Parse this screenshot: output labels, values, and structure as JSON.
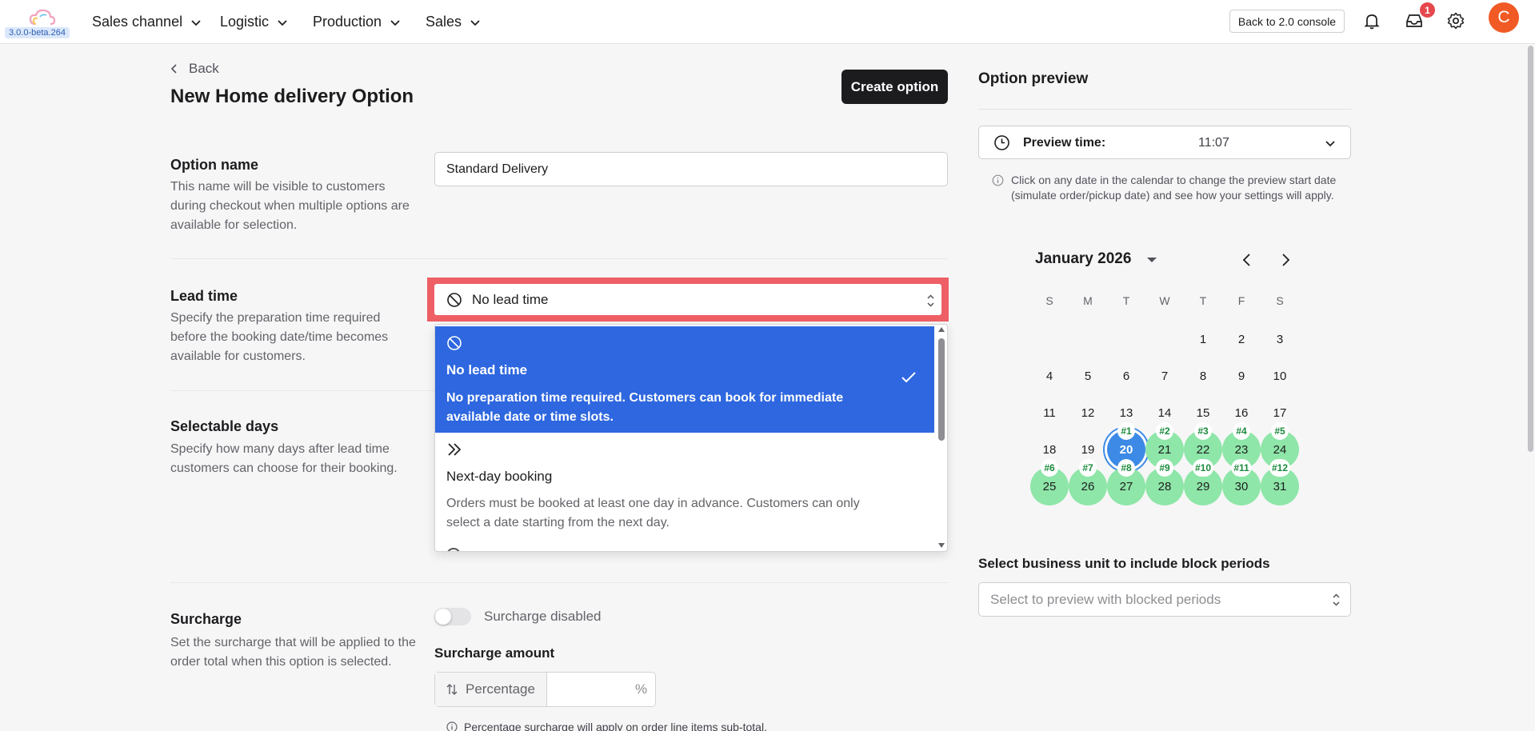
{
  "app": {
    "version": "3.0.0-beta.264"
  },
  "nav": {
    "items": [
      {
        "label": "Sales channel"
      },
      {
        "label": "Logistic"
      },
      {
        "label": "Production"
      },
      {
        "label": "Sales"
      }
    ]
  },
  "header": {
    "back_console": "Back to 2.0 console",
    "inbox_badge": "1",
    "avatar_initial": "C"
  },
  "page": {
    "back": "Back",
    "title": "New Home delivery Option",
    "create_button": "Create option"
  },
  "option_name": {
    "title": "Option name",
    "desc": "This name will be visible to customers during checkout when multiple options are available for selection.",
    "value": "Standard Delivery"
  },
  "lead_time": {
    "title": "Lead time",
    "desc": "Specify the preparation time required before the booking date/time becomes available for customers.",
    "selected": "No lead time",
    "options": [
      {
        "title": "No lead time",
        "desc": "No preparation time required. Customers can book for immediate available date or time slots.",
        "icon": "ban-icon",
        "selected": true
      },
      {
        "title": "Next-day booking",
        "desc": "Orders must be booked at least one day in advance. Customers can only select a date starting from the next day.",
        "icon": "double-chevron-right-icon"
      }
    ]
  },
  "selectable_days": {
    "title": "Selectable days",
    "desc": "Specify how many days after lead time customers can choose for their booking."
  },
  "surcharge": {
    "title": "Surcharge",
    "desc": "Set the surcharge that will be applied to the order total when this option is selected.",
    "toggle_label": "Surcharge disabled",
    "enabled": false,
    "amount_label": "Surcharge amount",
    "type": "Percentage",
    "unit": "%",
    "note": "Percentage surcharge will apply on order line items sub-total."
  },
  "preview": {
    "title": "Option preview",
    "time_label": "Preview time:",
    "time_value": "11:07",
    "info": "Click on any date in the calendar to change the preview start date (simulate order/pickup date) and see how your settings will apply.",
    "month": "January 2026",
    "weekdays": [
      "S",
      "M",
      "T",
      "W",
      "T",
      "F",
      "S"
    ],
    "today": 20,
    "tags": {
      "20": "#1",
      "21": "#2",
      "22": "#3",
      "23": "#4",
      "24": "#5",
      "25": "#6",
      "26": "#7",
      "27": "#8",
      "28": "#9",
      "29": "#10",
      "30": "#11",
      "31": "#12"
    },
    "business_unit_label": "Select business unit to include block periods",
    "business_unit_placeholder": "Select to preview with blocked periods"
  },
  "colors": {
    "primary": "#2e67df",
    "highlight": "#ee5f66",
    "available": "#8ee6a8",
    "today": "#3c8ae6",
    "avatar": "#f15a24",
    "button": "#1c1c1e"
  }
}
